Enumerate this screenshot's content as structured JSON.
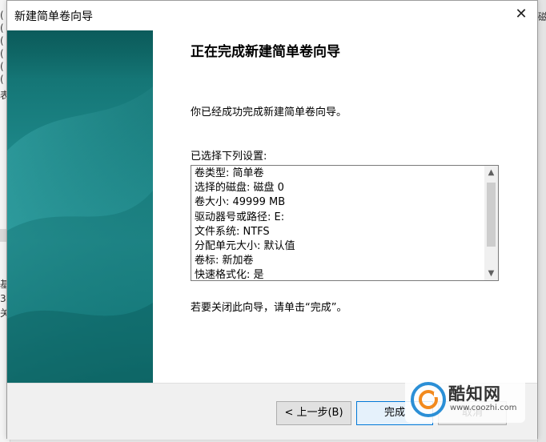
{
  "window": {
    "title": "新建简单卷向导",
    "close_glyph": "✕"
  },
  "main": {
    "heading": "正在完成新建简单卷向导",
    "description": "你已经成功完成新建简单卷向导。",
    "settings_label": "已选择下列设置:",
    "settings": [
      "卷类型: 简单卷",
      "选择的磁盘: 磁盘 0",
      "卷大小: 49999 MB",
      "驱动器号或路径: E:",
      "文件系统: NTFS",
      "分配单元大小: 默认值",
      "卷标: 新加卷",
      "快速格式化: 是"
    ],
    "close_hint": "若要关闭此向导，请单击“完成”。"
  },
  "footer": {
    "back_label": "< 上一步(B)",
    "finish_label": "完成",
    "cancel_label": "取消"
  },
  "scrollbar": {
    "up_glyph": "▲",
    "down_glyph": "▼"
  },
  "background": {
    "left_fragments": [
      "(",
      "(",
      "(",
      "(",
      "(",
      "(",
      "表",
      "基",
      "3",
      "关"
    ],
    "right_fragment": "磁"
  },
  "watermark": {
    "name": "酷知网",
    "url": "www.coozhi.com"
  },
  "colors": {
    "banner_teal": "#1b8384",
    "focus_blue": "#0078d7"
  }
}
